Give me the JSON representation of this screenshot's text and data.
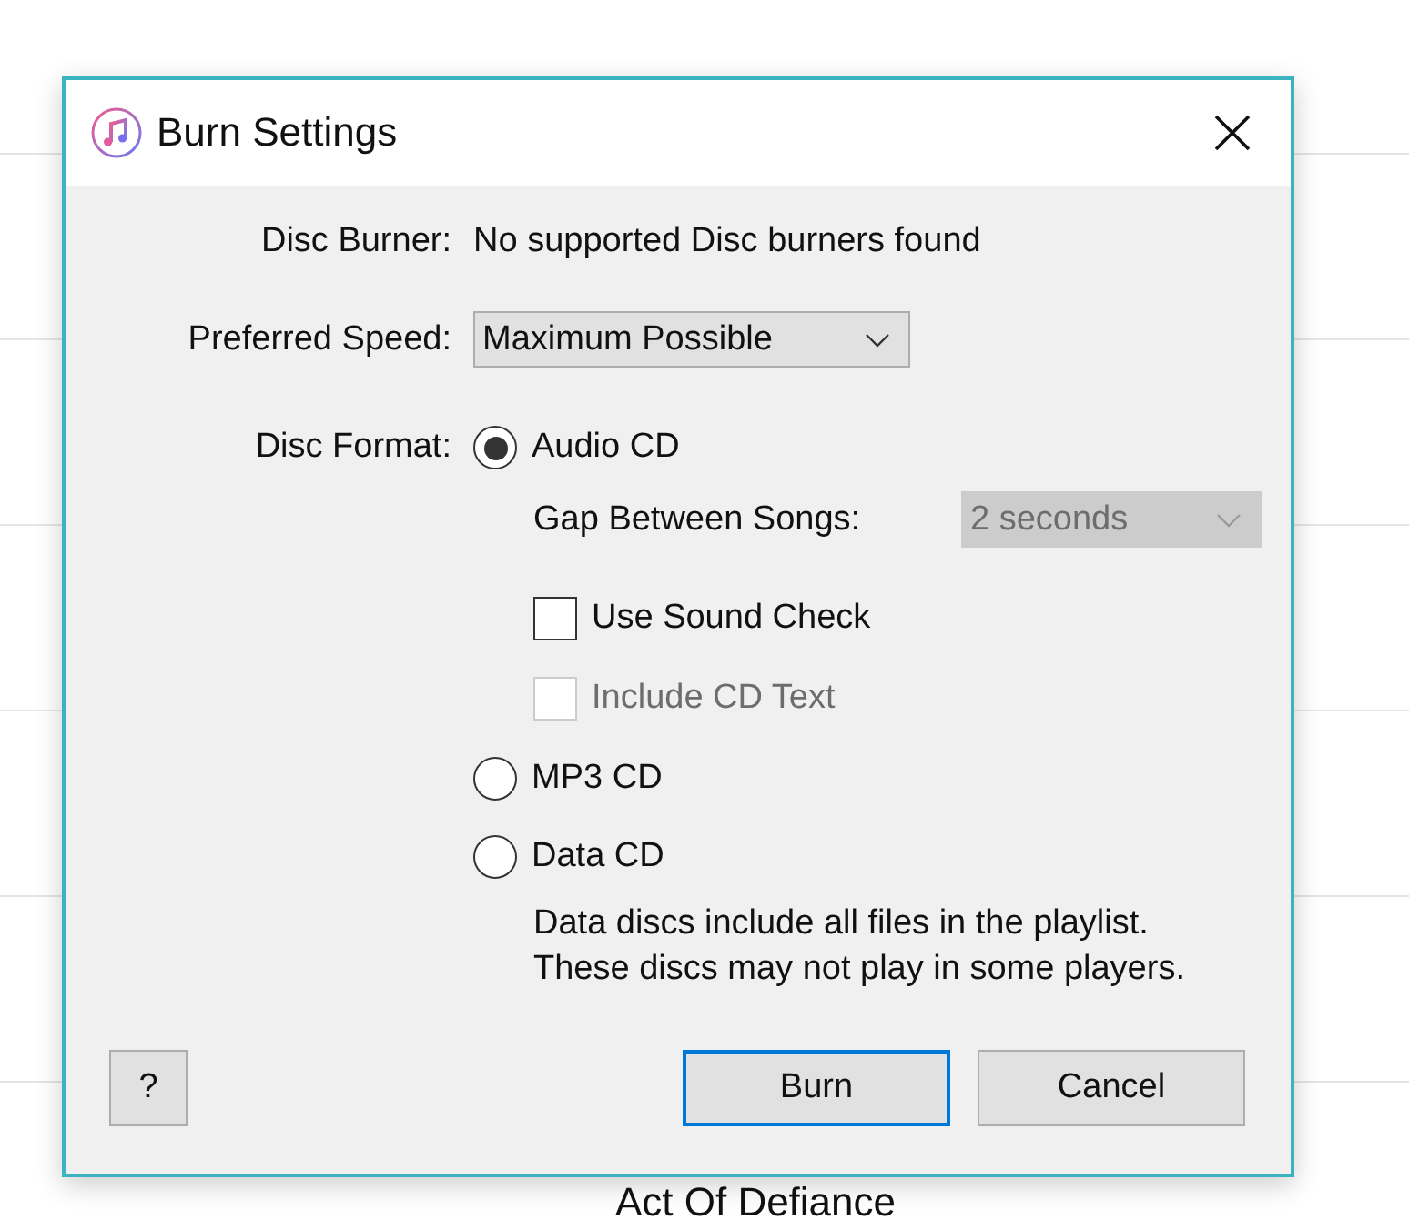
{
  "background": {
    "album_title": "Act Of Defiance"
  },
  "window": {
    "title": "Burn Settings"
  },
  "disc_burner": {
    "label": "Disc Burner:",
    "value": "No supported Disc burners found"
  },
  "preferred_speed": {
    "label": "Preferred Speed:",
    "value": "Maximum Possible"
  },
  "disc_format": {
    "label": "Disc Format:",
    "options": [
      {
        "label": "Audio CD",
        "selected": true,
        "gap": {
          "label": "Gap Between Songs:",
          "value": "2 seconds",
          "disabled": true
        },
        "checkboxes": [
          {
            "label": "Use Sound Check",
            "checked": false,
            "disabled": false
          },
          {
            "label": "Include CD Text",
            "checked": false,
            "disabled": true
          }
        ]
      },
      {
        "label": "MP3 CD",
        "selected": false
      },
      {
        "label": "Data CD",
        "selected": false,
        "note": "Data discs include all files in the playlist. These discs may not play in some players."
      }
    ]
  },
  "buttons": {
    "help": "?",
    "burn": "Burn",
    "cancel": "Cancel"
  }
}
